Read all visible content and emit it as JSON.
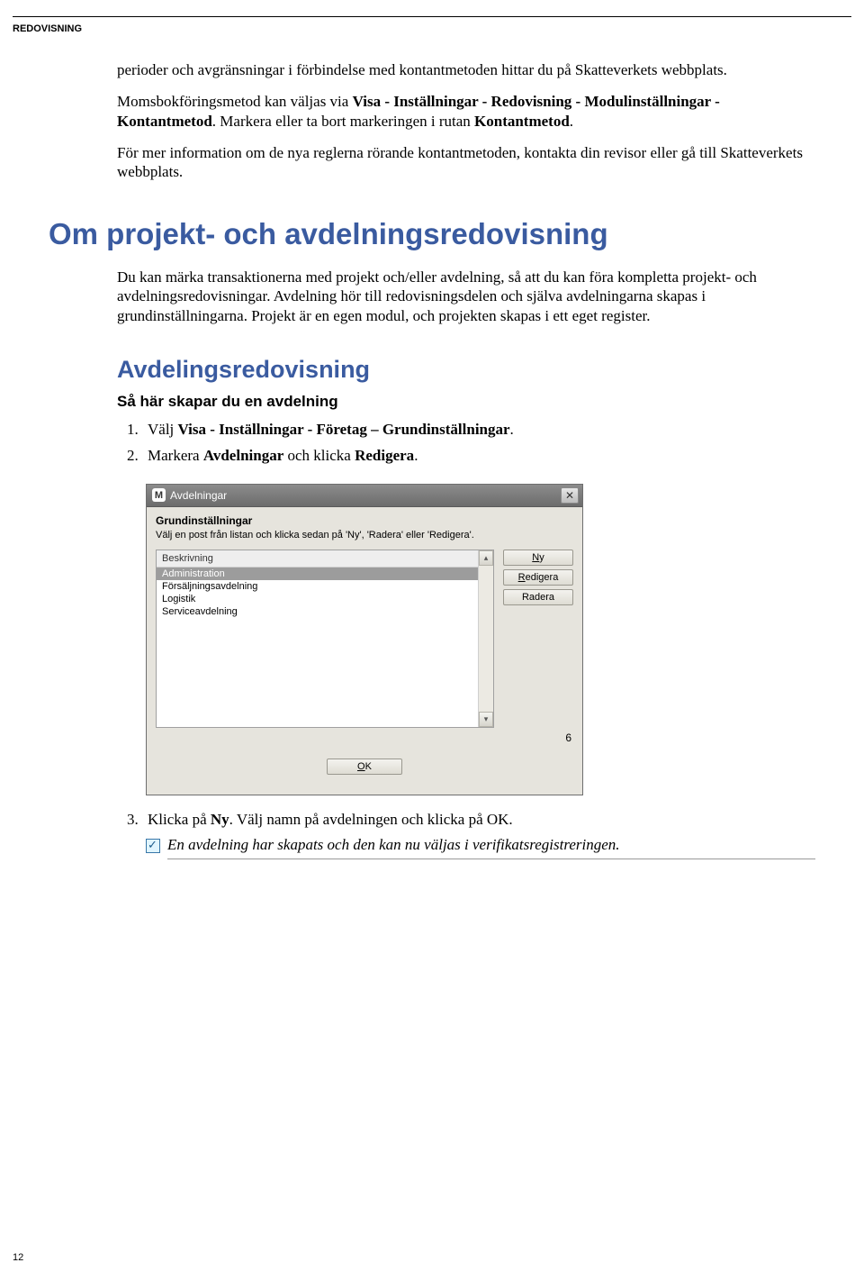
{
  "header": "REDOVISNING",
  "intro": {
    "p1": "perioder och avgränsningar i förbindelse med kontantmetoden hittar du på Skatteverkets webbplats.",
    "p2a": "Momsbokföringsmetod kan väljas via ",
    "p2b": "Visa - Inställningar - Redovisning - Modulinställningar - Kontantmetod",
    "p2c": ". Markera eller ta bort markeringen i rutan ",
    "p2d": "Kontantmetod",
    "p2e": ".",
    "p3": "För mer information om de nya reglerna rörande kontantmetoden, kontakta din revisor eller gå till Skatteverkets webbplats."
  },
  "h1": "Om projekt- och avdelningsredovisning",
  "section_p": "Du kan märka transaktionerna med projekt och/eller avdelning, så att du kan föra kompletta projekt- och avdelningsredovisningar. Avdelning hör till redovisningsdelen och själva avdelningarna skapas i grundinställningarna. Projekt är en egen modul, och projekten skapas i ett eget register.",
  "h2": "Avdelingsredovisning",
  "h3": "Så här skapar du en avdelning",
  "steps": [
    {
      "pre": "Välj ",
      "bold": "Visa - Inställningar - Företag – Grundinställningar",
      "post": "."
    },
    {
      "pre": "Markera ",
      "bold": "Avdelningar",
      "mid": " och klicka ",
      "bold2": "Redigera",
      "post": "."
    }
  ],
  "dialog": {
    "title": "Avdelningar",
    "heading": "Grundinställningar",
    "subtitle": "Välj en post från listan och klicka sedan på 'Ny', 'Radera' eller 'Redigera'.",
    "column": "Beskrivning",
    "items": [
      "Administration",
      "Försäljningsavdelning",
      "Logistik",
      "Serviceavdelning"
    ],
    "buttons": {
      "ny": "Ny",
      "redigera": "Redigera",
      "radera": "Radera",
      "ok": "OK"
    },
    "count": "6"
  },
  "step3": {
    "pre": "Klicka på ",
    "bold": "Ny",
    "post": ". Välj namn på avdelningen och klicka på OK."
  },
  "note": "En avdelning har skapats och den kan nu väljas i verifikatsregistreringen.",
  "page_number": "12"
}
